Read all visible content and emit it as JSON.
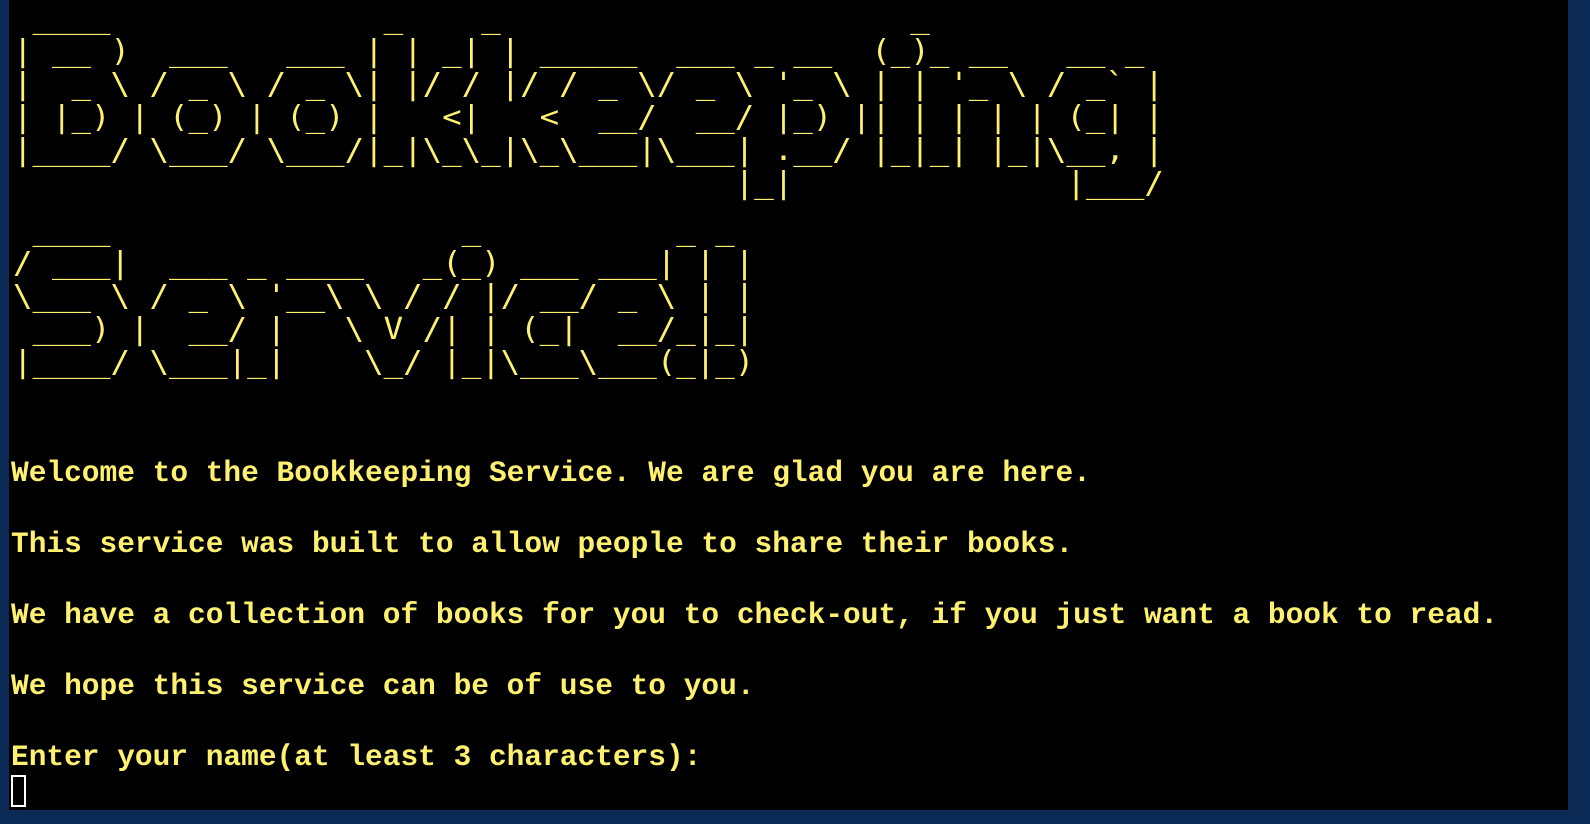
{
  "banner": {
    "line1": " ____              _    _                     _             \n| __ )  ___   ___ | | _| | _____  ___ _ __  (_)_ __   __ _ \n|  _ \\ / _ \\ / _ \\| |/ / |/ / _ \\/ _ \\ '_ \\ | | '_ \\ / _` |\n| |_) | (_) | (_) |   <|   <  __/  __/ |_) || | | | | (_| |\n|____/ \\___/ \\___/|_|\\_\\_|\\_\\___|\\___| .__/ |_|_| |_|\\__, |\n                                     |_|              |___/ ",
    "line2": " ____                  _          _ _ \n/ ___|  ___ _ ____   _(_) ___ ___| | |\n\\___ \\ / _ \\ '__\\ \\ / / |/ __/ _ \\ | |\n ___) |  __/ |   \\ V /| | (_|  __/_|_|\n|____/ \\___|_|    \\_/ |_|\\___\\___(_|_)"
  },
  "messages": {
    "welcome": "Welcome to the Bookkeeping Service. We are glad you are here.",
    "purpose": "This service was built to allow people to share their books.",
    "collection": "We have a collection of books for you to check-out, if you just want a book to read.",
    "hope": "We hope this service can be of use to you.",
    "prompt": "Enter your name(at least 3 characters):"
  },
  "colors": {
    "text": "#fff170",
    "background": "#000000",
    "frame": "#0b2a55",
    "cursor": "#ffffff"
  }
}
